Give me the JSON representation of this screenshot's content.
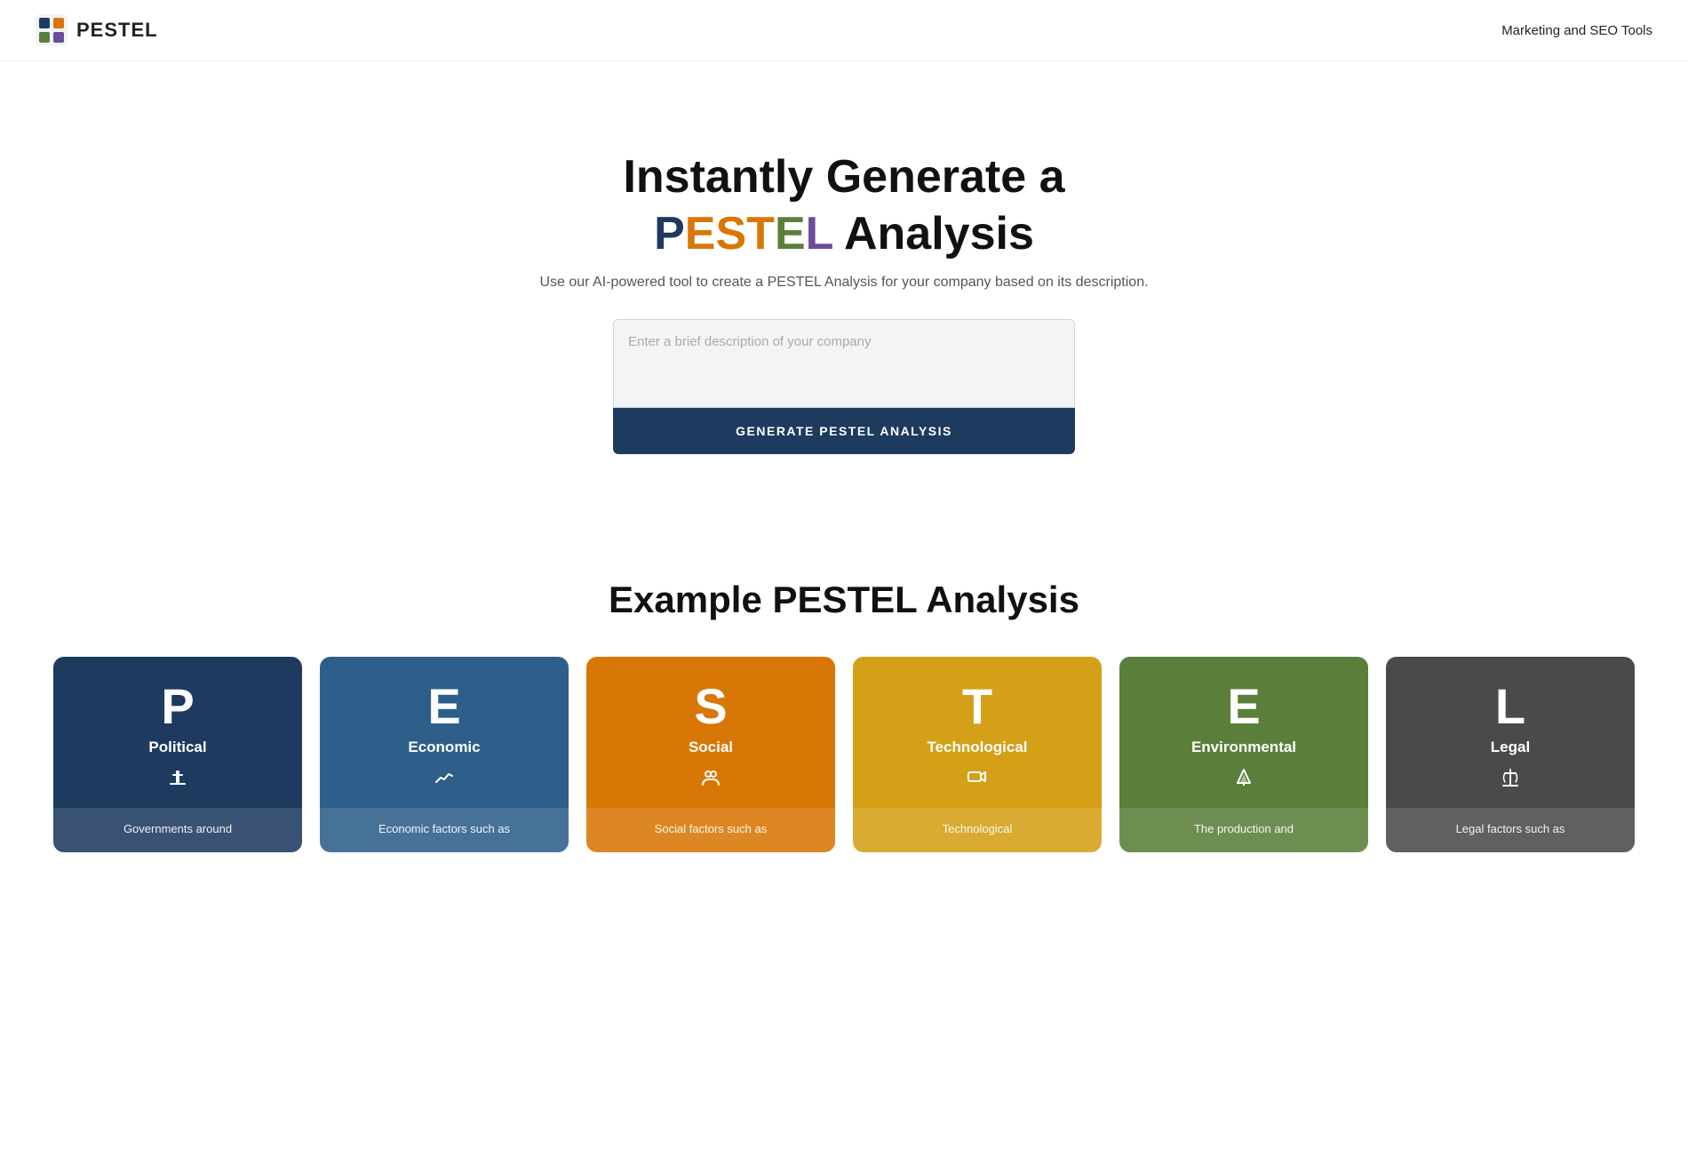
{
  "header": {
    "logo_text": "PESTEL",
    "nav_label": "Marketing and SEO Tools"
  },
  "hero": {
    "title_line1": "Instantly Generate a",
    "title_line2_prefix": " Analysis",
    "pestel_letters": {
      "P": "P",
      "E": "E",
      "S": "S",
      "T": "T",
      "E2": "E",
      "L": "L"
    },
    "subtitle": "Use our AI-powered tool to create a PESTEL Analysis for your company based on its description.",
    "textarea_placeholder": "Enter a brief description of your company",
    "generate_button": "GENERATE PESTEL ANALYSIS"
  },
  "example_section": {
    "title": "Example PESTEL Analysis"
  },
  "cards": [
    {
      "id": "political",
      "letter": "P",
      "title": "Political",
      "icon": "🏛",
      "body": "Governments around",
      "color_class": "card-political"
    },
    {
      "id": "economic",
      "letter": "E",
      "title": "Economic",
      "icon": "📈",
      "body": "Economic factors such as",
      "color_class": "card-economic"
    },
    {
      "id": "social",
      "letter": "S",
      "title": "Social",
      "icon": "👥",
      "body": "Social factors such as",
      "color_class": "card-social"
    },
    {
      "id": "technological",
      "letter": "T",
      "title": "Technological",
      "icon": "🤖",
      "body": "Technological",
      "color_class": "card-technological"
    },
    {
      "id": "environmental",
      "letter": "E",
      "title": "Environmental",
      "icon": "🌲",
      "body": "The production and",
      "color_class": "card-environmental"
    },
    {
      "id": "legal",
      "letter": "L",
      "title": "Legal",
      "icon": "⚖",
      "body": "Legal factors such as",
      "color_class": "card-legal"
    }
  ]
}
